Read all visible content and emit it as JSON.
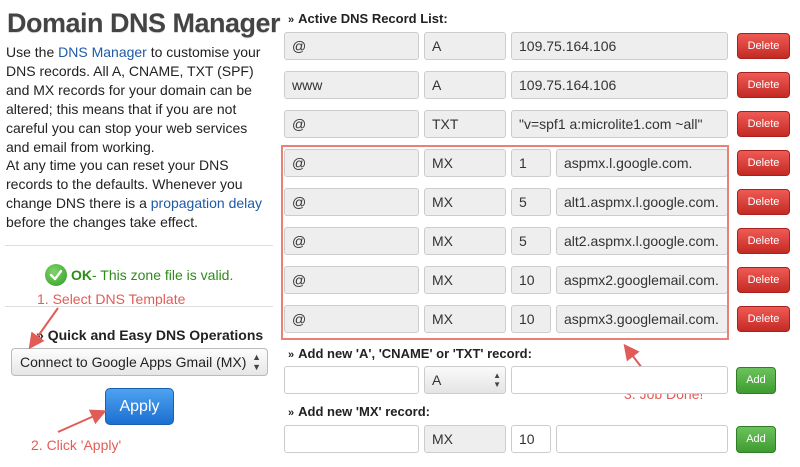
{
  "left": {
    "title": "Domain DNS Manager",
    "p1_a": "Use the ",
    "p1_link": "DNS Manager",
    "p1_b": " to customise your DNS records. All A, CNAME, TXT (SPF) and MX records for your domain can be altered; this means that if you are not careful you can stop your web services and email from working.",
    "p2_a": "At any time you can reset your DNS records to the defaults. Whenever you change DNS there is a ",
    "p2_link": "propagation delay",
    "p2_b": " before the changes take effect.",
    "ok_word": "OK",
    "ok_text": " - This zone file is valid.",
    "quick_title": "Quick and Easy DNS Operations",
    "template_select": "Connect to Google Apps Gmail (MX)",
    "apply_label": "Apply"
  },
  "annotations": {
    "step1": "1. Select DNS Template",
    "step2": "2. Click 'Apply'",
    "step3": "3. Job Done!"
  },
  "records": {
    "section_title": "Active DNS Record List:",
    "delete_label": "Delete",
    "rows": [
      {
        "host": "@",
        "type": "A",
        "priority": "",
        "value": "109.75.164.106"
      },
      {
        "host": "www",
        "type": "A",
        "priority": "",
        "value": "109.75.164.106"
      },
      {
        "host": "@",
        "type": "TXT",
        "priority": "",
        "value": "\"v=spf1 a:microlite1.com ~all\""
      },
      {
        "host": "@",
        "type": "MX",
        "priority": "1",
        "value": "aspmx.l.google.com."
      },
      {
        "host": "@",
        "type": "MX",
        "priority": "5",
        "value": "alt1.aspmx.l.google.com."
      },
      {
        "host": "@",
        "type": "MX",
        "priority": "5",
        "value": "alt2.aspmx.l.google.com."
      },
      {
        "host": "@",
        "type": "MX",
        "priority": "10",
        "value": "aspmx2.googlemail.com."
      },
      {
        "host": "@",
        "type": "MX",
        "priority": "10",
        "value": "aspmx3.googlemail.com."
      }
    ]
  },
  "add_record": {
    "title": "Add new 'A', 'CNAME' or 'TXT' record:",
    "type_value": "A",
    "add_label": "Add"
  },
  "add_mx": {
    "title": "Add new 'MX' record:",
    "type_value": "MX",
    "priority_value": "10",
    "add_label": "Add"
  }
}
